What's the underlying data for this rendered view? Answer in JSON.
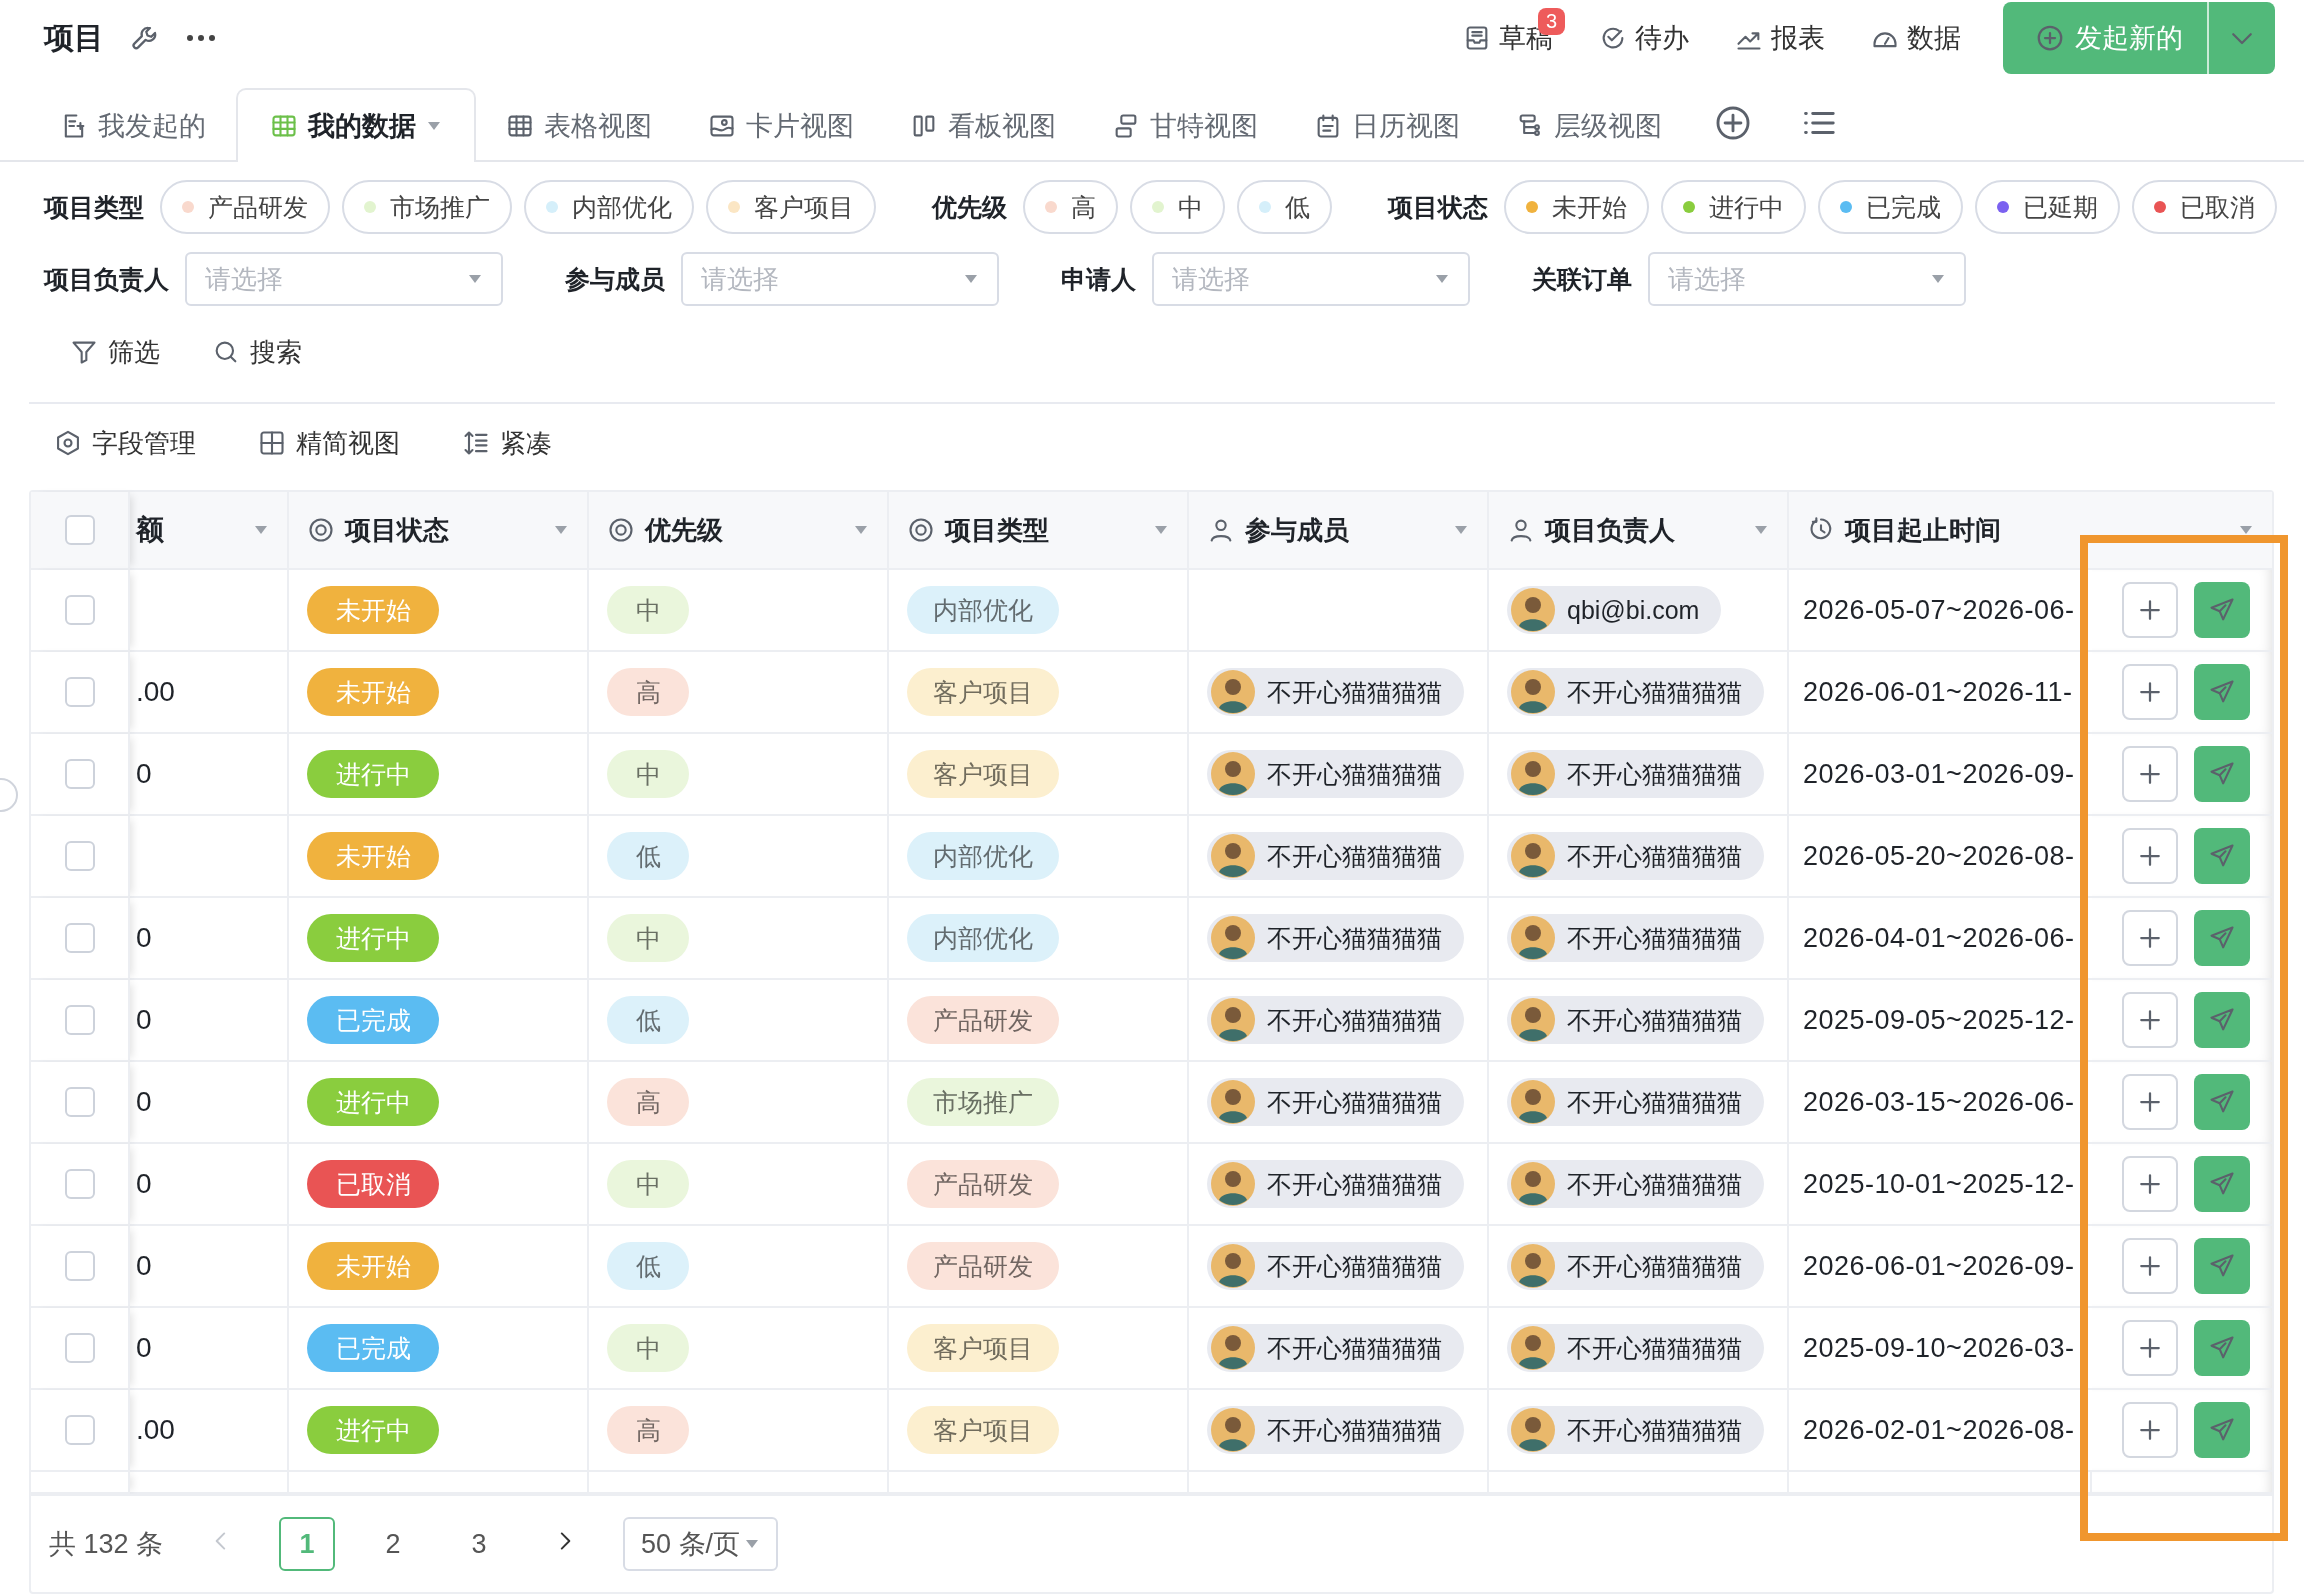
{
  "header": {
    "title": "项目"
  },
  "top_actions": [
    {
      "label": "草稿",
      "badge": "3",
      "kind": "drafts"
    },
    {
      "label": "待办",
      "kind": "todo"
    },
    {
      "label": "报表",
      "kind": "report"
    },
    {
      "label": "数据",
      "kind": "data"
    }
  ],
  "primary_button": {
    "label": "发起新的"
  },
  "tabs": [
    {
      "label": "我发起的",
      "kind": "mine",
      "selected": false
    },
    {
      "label": "我的数据",
      "kind": "grid",
      "selected": true
    },
    {
      "label": "表格视图",
      "kind": "table",
      "selected": false
    },
    {
      "label": "卡片视图",
      "kind": "card",
      "selected": false
    },
    {
      "label": "看板视图",
      "kind": "board",
      "selected": false
    },
    {
      "label": "甘特视图",
      "kind": "gantt",
      "selected": false
    },
    {
      "label": "日历视图",
      "kind": "calendar",
      "selected": false
    },
    {
      "label": "层级视图",
      "kind": "tree",
      "selected": false
    }
  ],
  "filters": {
    "groups": [
      {
        "label": "项目类型",
        "options": [
          {
            "label": "产品研发",
            "color": "#f9d9cd"
          },
          {
            "label": "市场推广",
            "color": "#e2f4cf"
          },
          {
            "label": "内部优化",
            "color": "#d5effa"
          },
          {
            "label": "客户项目",
            "color": "#fbe6c4"
          }
        ]
      },
      {
        "label": "优先级",
        "options": [
          {
            "label": "高",
            "color": "#f9d9cd"
          },
          {
            "label": "中",
            "color": "#e2f4cf"
          },
          {
            "label": "低",
            "color": "#d5effa"
          }
        ]
      },
      {
        "label": "项目状态",
        "options": [
          {
            "label": "未开始",
            "color": "#f0b23e"
          },
          {
            "label": "进行中",
            "color": "#8acd3e"
          },
          {
            "label": "已完成",
            "color": "#5bbcf2"
          },
          {
            "label": "已延期",
            "color": "#7b61f0"
          },
          {
            "label": "已取消",
            "color": "#e95454"
          }
        ]
      }
    ],
    "selects": [
      {
        "label": "项目负责人",
        "placeholder": "请选择"
      },
      {
        "label": "参与成员",
        "placeholder": "请选择"
      },
      {
        "label": "申请人",
        "placeholder": "请选择"
      },
      {
        "label": "关联订单",
        "placeholder": "请选择"
      }
    ],
    "actions": [
      {
        "label": "筛选",
        "kind": "filter"
      },
      {
        "label": "搜索",
        "kind": "search"
      }
    ]
  },
  "toolbar": [
    {
      "label": "字段管理",
      "kind": "fields"
    },
    {
      "label": "精简视图",
      "kind": "compact-view"
    },
    {
      "label": "紧凑",
      "kind": "density"
    }
  ],
  "table": {
    "header_checkbox": {
      "checked": false
    },
    "columns": [
      {
        "label": "额",
        "kind": "plain"
      },
      {
        "label": "项目状态",
        "kind": "option"
      },
      {
        "label": "优先级",
        "kind": "option"
      },
      {
        "label": "项目类型",
        "kind": "option"
      },
      {
        "label": "参与成员",
        "kind": "person"
      },
      {
        "label": "项目负责人",
        "kind": "person"
      },
      {
        "label": "项目起止时间",
        "kind": "time"
      }
    ],
    "rows": [
      {
        "checked": false,
        "amount": "",
        "status": {
          "text": "未开始",
          "color": "#f0b23e"
        },
        "priority": {
          "text": "中",
          "color": "#eaf6dc"
        },
        "type": {
          "text": "内部优化",
          "color": "#dcf1fa"
        },
        "members": [],
        "owner": {
          "name": "qbi@bi.com"
        },
        "period": "2026-05-07~2026-06-"
      },
      {
        "checked": false,
        "amount": ".00",
        "status": {
          "text": "未开始",
          "color": "#f0b23e"
        },
        "priority": {
          "text": "高",
          "color": "#fbe3da"
        },
        "type": {
          "text": "客户项目",
          "color": "#fcefcf"
        },
        "members": [
          {
            "name": "不开心猫猫猫猫"
          }
        ],
        "owner": {
          "name": "不开心猫猫猫猫"
        },
        "period": "2026-06-01~2026-11-"
      },
      {
        "checked": false,
        "amount": "0",
        "status": {
          "text": "进行中",
          "color": "#8acd3e"
        },
        "priority": {
          "text": "中",
          "color": "#eaf6dc"
        },
        "type": {
          "text": "客户项目",
          "color": "#fcefcf"
        },
        "members": [
          {
            "name": "不开心猫猫猫猫"
          }
        ],
        "owner": {
          "name": "不开心猫猫猫猫"
        },
        "period": "2026-03-01~2026-09-"
      },
      {
        "checked": false,
        "amount": "",
        "status": {
          "text": "未开始",
          "color": "#f0b23e"
        },
        "priority": {
          "text": "低",
          "color": "#dcf1fa"
        },
        "type": {
          "text": "内部优化",
          "color": "#dcf1fa"
        },
        "members": [
          {
            "name": "不开心猫猫猫猫"
          }
        ],
        "owner": {
          "name": "不开心猫猫猫猫"
        },
        "period": "2026-05-20~2026-08-"
      },
      {
        "checked": false,
        "amount": "0",
        "status": {
          "text": "进行中",
          "color": "#8acd3e"
        },
        "priority": {
          "text": "中",
          "color": "#eaf6dc"
        },
        "type": {
          "text": "内部优化",
          "color": "#dcf1fa"
        },
        "members": [
          {
            "name": "不开心猫猫猫猫"
          }
        ],
        "owner": {
          "name": "不开心猫猫猫猫"
        },
        "period": "2026-04-01~2026-06-"
      },
      {
        "checked": false,
        "amount": "0",
        "status": {
          "text": "已完成",
          "color": "#5bbcf2"
        },
        "priority": {
          "text": "低",
          "color": "#dcf1fa"
        },
        "type": {
          "text": "产品研发",
          "color": "#fbe3da"
        },
        "members": [
          {
            "name": "不开心猫猫猫猫"
          }
        ],
        "owner": {
          "name": "不开心猫猫猫猫"
        },
        "period": "2025-09-05~2025-12-"
      },
      {
        "checked": false,
        "amount": "0",
        "status": {
          "text": "进行中",
          "color": "#8acd3e"
        },
        "priority": {
          "text": "高",
          "color": "#fbe3da"
        },
        "type": {
          "text": "市场推广",
          "color": "#eaf6dc"
        },
        "members": [
          {
            "name": "不开心猫猫猫猫"
          }
        ],
        "owner": {
          "name": "不开心猫猫猫猫"
        },
        "period": "2026-03-15~2026-06-"
      },
      {
        "checked": false,
        "amount": "0",
        "status": {
          "text": "已取消",
          "color": "#e95454"
        },
        "priority": {
          "text": "中",
          "color": "#eaf6dc"
        },
        "type": {
          "text": "产品研发",
          "color": "#fbe3da"
        },
        "members": [
          {
            "name": "不开心猫猫猫猫"
          }
        ],
        "owner": {
          "name": "不开心猫猫猫猫"
        },
        "period": "2025-10-01~2025-12-"
      },
      {
        "checked": false,
        "amount": "0",
        "status": {
          "text": "未开始",
          "color": "#f0b23e"
        },
        "priority": {
          "text": "低",
          "color": "#dcf1fa"
        },
        "type": {
          "text": "产品研发",
          "color": "#fbe3da"
        },
        "members": [
          {
            "name": "不开心猫猫猫猫"
          }
        ],
        "owner": {
          "name": "不开心猫猫猫猫"
        },
        "period": "2026-06-01~2026-09-"
      },
      {
        "checked": false,
        "amount": "0",
        "status": {
          "text": "已完成",
          "color": "#5bbcf2"
        },
        "priority": {
          "text": "中",
          "color": "#eaf6dc"
        },
        "type": {
          "text": "客户项目",
          "color": "#fcefcf"
        },
        "members": [
          {
            "name": "不开心猫猫猫猫"
          }
        ],
        "owner": {
          "name": "不开心猫猫猫猫"
        },
        "period": "2025-09-10~2026-03-"
      },
      {
        "checked": false,
        "amount": ".00",
        "status": {
          "text": "进行中",
          "color": "#8acd3e"
        },
        "priority": {
          "text": "高",
          "color": "#fbe3da"
        },
        "type": {
          "text": "客户项目",
          "color": "#fcefcf"
        },
        "members": [
          {
            "name": "不开心猫猫猫猫"
          }
        ],
        "owner": {
          "name": "不开心猫猫猫猫"
        },
        "period": "2026-02-01~2026-08-"
      }
    ]
  },
  "pagination": {
    "total": "共 132 条",
    "prev": {
      "disabled": true
    },
    "next": {
      "disabled": false
    },
    "pages": [
      {
        "label": "1",
        "selected": true
      },
      {
        "label": "2",
        "selected": false
      },
      {
        "label": "3",
        "selected": false
      }
    ],
    "page_size": "50 条/页"
  }
}
